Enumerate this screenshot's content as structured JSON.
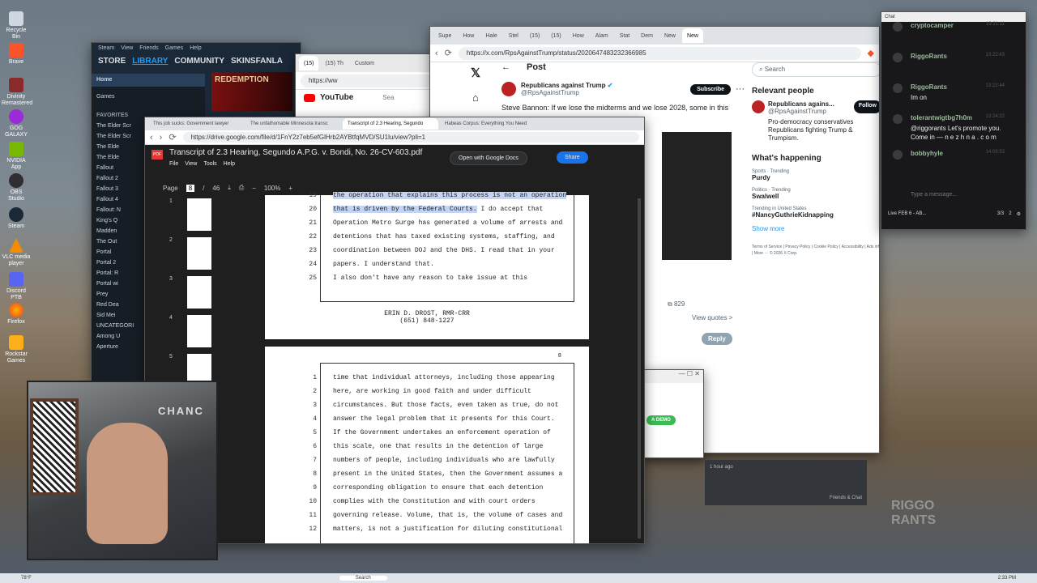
{
  "desktop": {
    "icons": [
      "Recycle Bin",
      "Brave",
      "Divinity Remastered",
      "GOG GALAXY",
      "NVIDIA App",
      "OBS Studio",
      "Steam",
      "VLC media player",
      "Discord PTB",
      "Firefox",
      "Rockstar Games"
    ]
  },
  "steam": {
    "menu": [
      "Steam",
      "View",
      "Friends",
      "Games",
      "Help"
    ],
    "nav": [
      "STORE",
      "LIBRARY",
      "COMMUNITY",
      "SKINSFANLA"
    ],
    "home": "Home",
    "games": "Games",
    "favorites": "FAVORITES",
    "uncategorized": "UNCATEGORI",
    "items": [
      "The Elder Scr",
      "The Elder Scr",
      "The Elde",
      "The Elde",
      "Fallout",
      "Fallout 2",
      "Fallout 3",
      "Fallout 4",
      "Fallout: N",
      "King's Q",
      "Madden",
      "The Out",
      "Portal",
      "Portal 2",
      "Portal: R",
      "Portal wi",
      "Prey",
      "Red Dea",
      "Sid Mei",
      "Among U",
      "Aperture"
    ],
    "banner": "REDEMPTION"
  },
  "youtube": {
    "tab1": "(15)",
    "tab2": "(15) Th",
    "tab3": "Custom",
    "url": "https://ww",
    "logo": "YouTube",
    "search": "Sea"
  },
  "x": {
    "tabs": [
      "Supe",
      "How",
      "Hale",
      "Stel",
      "(15)",
      "(15)",
      "How",
      "Alam",
      "Stat",
      "Dem",
      "New",
      "New"
    ],
    "url": "https://x.com/RpsAgainstTrump/status/2020647483232366985",
    "post_header": "Post",
    "author": "Republicans against Trump",
    "handle": "@RpsAgainstTrump",
    "subscribe": "Subscribe",
    "text": "Steve Bannon: If we lose the midterms and we lose 2028, some in this",
    "search": "Search",
    "relevant": "Relevant people",
    "rel_name": "Republicans agains...",
    "rel_handle": "@RpsAgainstTrump",
    "rel_bio": "Pro-democracy conservatives Republicans fighting Trump & Trumpism.",
    "follow": "Follow",
    "happening": "What's happening",
    "trends": [
      {
        "cat": "Sports · Trending",
        "name": "Purdy"
      },
      {
        "cat": "Politics · Trending",
        "name": "Swalwell"
      },
      {
        "cat": "Trending in United States",
        "name": "#NancyGuthrieKidnapping"
      }
    ],
    "show_more": "Show more",
    "footer": "Terms of Service  |  Privacy Policy  |  Cookie Policy  |  Accessibility  |  Ads info  |  More ···  © 2026 X Corp.",
    "bookmarks": "829",
    "view_quotes": "View quotes >",
    "reply": "Reply"
  },
  "pdf": {
    "tabs": [
      "This job sucks: Government lawyer",
      "The unfathomable Minnesota transc",
      "Transcript of 2.3 Hearing, Segundo",
      "Habeas Corpus: Everything You Need"
    ],
    "url": "https://drive.google.com/file/d/1FnY2z7eb5efGlHrb2AYBtfqMVD/SU1lu/view?pli=1",
    "title": "Transcript of 2.3 Hearing, Segundo A.P.G. v. Bondi, No. 26-CV-603.pdf",
    "menu": [
      "File",
      "View",
      "Tools",
      "Help"
    ],
    "open_with": "Open with Google Docs",
    "share": "Share",
    "page_label": "Page",
    "page": "8",
    "of": "/",
    "total": "46",
    "zoom": "100%",
    "thumbs": [
      "1",
      "2",
      "3",
      "4",
      "5"
    ],
    "reporter_name": "ERIN D. DROST, RMR-CRR",
    "reporter_phone": "(651) 848-1227",
    "page_num": "8",
    "page1": [
      {
        "n": "19",
        "t": "the operation that explains this process is not an operation",
        "h": true
      },
      {
        "n": "20",
        "t": "that is driven by the Federal Courts.",
        "t2": "  I do accept that",
        "h": true
      },
      {
        "n": "21",
        "t": "Operation Metro Surge has generated a volume of arrests and"
      },
      {
        "n": "22",
        "t": "detentions that has taxed existing systems, staffing, and"
      },
      {
        "n": "23",
        "t": "coordination between DOJ and the DHS.  I read that in your"
      },
      {
        "n": "24",
        "t": "papers.  I understand that."
      },
      {
        "n": "25",
        "t": "      I also don't have any reason to take issue at this"
      }
    ],
    "page2": [
      {
        "n": "1",
        "t": "time that individual attorneys, including those appearing"
      },
      {
        "n": "2",
        "t": "here, are working in good faith and under difficult"
      },
      {
        "n": "3",
        "t": "circumstances.  But those facts, even taken as true, do not"
      },
      {
        "n": "4",
        "t": "answer the legal problem that it presents for this Court."
      },
      {
        "n": "5",
        "t": "If the Government undertakes an enforcement operation of"
      },
      {
        "n": "6",
        "t": "this scale, one that results in the detention of large"
      },
      {
        "n": "7",
        "t": "numbers of people, including individuals who are lawfully"
      },
      {
        "n": "8",
        "t": "present in the United States, then the Government assumes a"
      },
      {
        "n": "9",
        "t": "corresponding obligation to ensure that each detention"
      },
      {
        "n": "10",
        "t": "complies with the Constitution and with court orders"
      },
      {
        "n": "11",
        "t": "governing release.  Volume, that is, the volume of cases and"
      },
      {
        "n": "12",
        "t": "matters, is not a justification for diluting constitutional"
      }
    ]
  },
  "chat": {
    "title": "Chat",
    "messages": [
      {
        "user": "cryptocamper",
        "time": "13:21:11",
        "text": ""
      },
      {
        "user": "RiggoRants",
        "time": "13:22:43",
        "text": ""
      },
      {
        "user": "RiggoRants",
        "time": "13:22:44",
        "text": "Im on"
      },
      {
        "user": "tolerantwigtbg7h0m",
        "time": "13:24:22",
        "text": "@riggorants Let's promote you. Come in — n e z h n a . c o m"
      },
      {
        "user": "bobbyhyle",
        "time": "14:03:53",
        "text": ""
      }
    ],
    "placeholder": "Type a message...",
    "live": "Live FEB 6 - AB...",
    "viewers": "3/3",
    "count": "2"
  },
  "small_win": {
    "demo": "A DEMO",
    "ago": "1 hour ago"
  },
  "friends": "Friends & Chat",
  "watermark": "RIGGO RANTS",
  "taskbar": {
    "weather": "78°F",
    "search": "Search",
    "time": "2:33 PM"
  },
  "webcam": {
    "sign": "CHANC"
  }
}
